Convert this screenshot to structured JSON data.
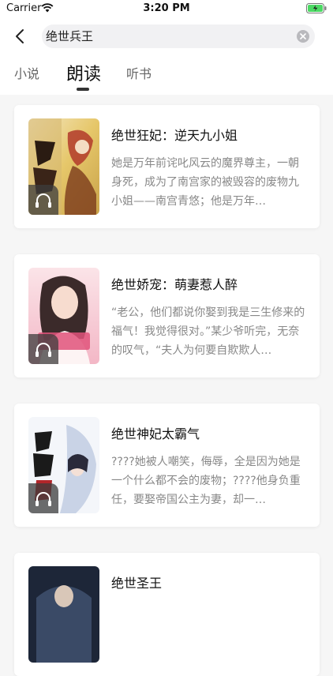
{
  "status_bar": {
    "carrier": "Carrier",
    "time": "3:20 PM"
  },
  "search": {
    "query": "绝世兵王"
  },
  "tabs": [
    {
      "label": "小说"
    },
    {
      "label": "朗读"
    },
    {
      "label": "听书"
    }
  ],
  "active_tab": "朗读",
  "books": [
    {
      "title": "绝世狂妃：逆天九小姐",
      "description": "她是万年前诧叱风云的魔界尊主，一朝身死，成为了南宫家的被毁容的废物九小姐——南宫青悠；他是万年…"
    },
    {
      "title": "绝世娇宠：萌妻惹人醉",
      "description": "“老公，他们都说你娶到我是三生修来的福气！我觉得很对。”某少爷听完，无奈的叹气，“夫人为何要自欺欺人…"
    },
    {
      "title": "绝世神妃太霸气",
      "description": "????她被人嘲笑，侮辱，全是因为她是一个什么都不会的废物；????他身负重任，要娶帝国公主为妻，却一…"
    },
    {
      "title": "绝世圣王",
      "description": ""
    }
  ],
  "colors": {
    "accent": "#333333",
    "muted": "#888888",
    "background": "#f6f6f6"
  },
  "icons": {
    "back": "chevron-left-icon",
    "clear": "clear-icon",
    "audio": "headphones-icon",
    "wifi": "wifi-icon",
    "battery": "battery-icon"
  }
}
